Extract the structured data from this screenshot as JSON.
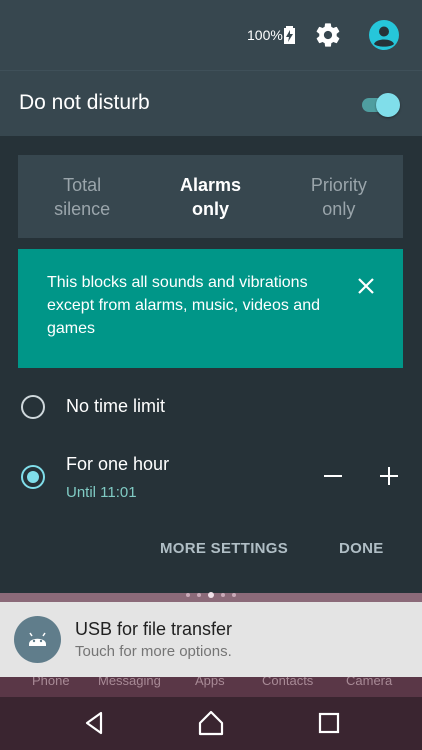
{
  "status_bar": {
    "battery_text": "100%",
    "icons": [
      "battery-charging-icon",
      "gear-icon",
      "account-icon"
    ]
  },
  "dnd": {
    "title": "Do not disturb",
    "enabled": true,
    "accent": "#80DEEA"
  },
  "modes": [
    {
      "label": "Total\nsilence",
      "selected": false
    },
    {
      "label": "Alarms\nonly",
      "selected": true
    },
    {
      "label": "Priority\nonly",
      "selected": false
    }
  ],
  "info": {
    "text": "This blocks all sounds and vibrations except from alarms, music, videos and games",
    "color": "#009688"
  },
  "duration": {
    "option1": "No time limit",
    "option2": "For one hour",
    "option2_sub": "Until 11:01"
  },
  "actions": {
    "more_settings": "MORE SETTINGS",
    "done": "DONE"
  },
  "notification": {
    "title": "USB for file transfer",
    "subtitle": "Touch for more options."
  },
  "dock": {
    "labels": [
      "Phone",
      "Messaging",
      "Apps",
      "Contacts",
      "Camera"
    ]
  },
  "nav": {
    "icons": [
      "back-icon",
      "home-icon",
      "recents-icon"
    ]
  }
}
